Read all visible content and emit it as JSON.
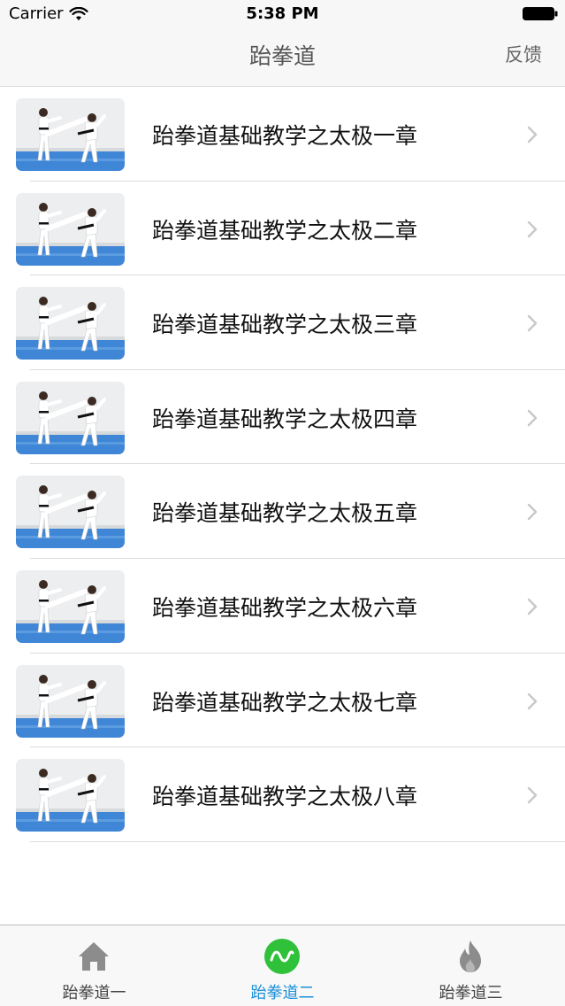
{
  "status_bar": {
    "carrier": "Carrier",
    "time": "5:38 PM"
  },
  "nav": {
    "title": "跆拳道",
    "feedback": "反馈"
  },
  "list": {
    "items": [
      {
        "label": "跆拳道基础教学之太极一章"
      },
      {
        "label": "跆拳道基础教学之太极二章"
      },
      {
        "label": "跆拳道基础教学之太极三章"
      },
      {
        "label": "跆拳道基础教学之太极四章"
      },
      {
        "label": "跆拳道基础教学之太极五章"
      },
      {
        "label": "跆拳道基础教学之太极六章"
      },
      {
        "label": "跆拳道基础教学之太极七章"
      },
      {
        "label": "跆拳道基础教学之太极八章"
      }
    ]
  },
  "tabs": [
    {
      "label": "跆拳道一",
      "icon": "home-icon",
      "active": false
    },
    {
      "label": "跆拳道二",
      "icon": "wave-icon",
      "active": true
    },
    {
      "label": "跆拳道三",
      "icon": "flame-icon",
      "active": false
    }
  ],
  "colors": {
    "accent": "#1a8fd9",
    "active_icon": "#2fc13a",
    "inactive_icon": "#8c8c8c"
  }
}
